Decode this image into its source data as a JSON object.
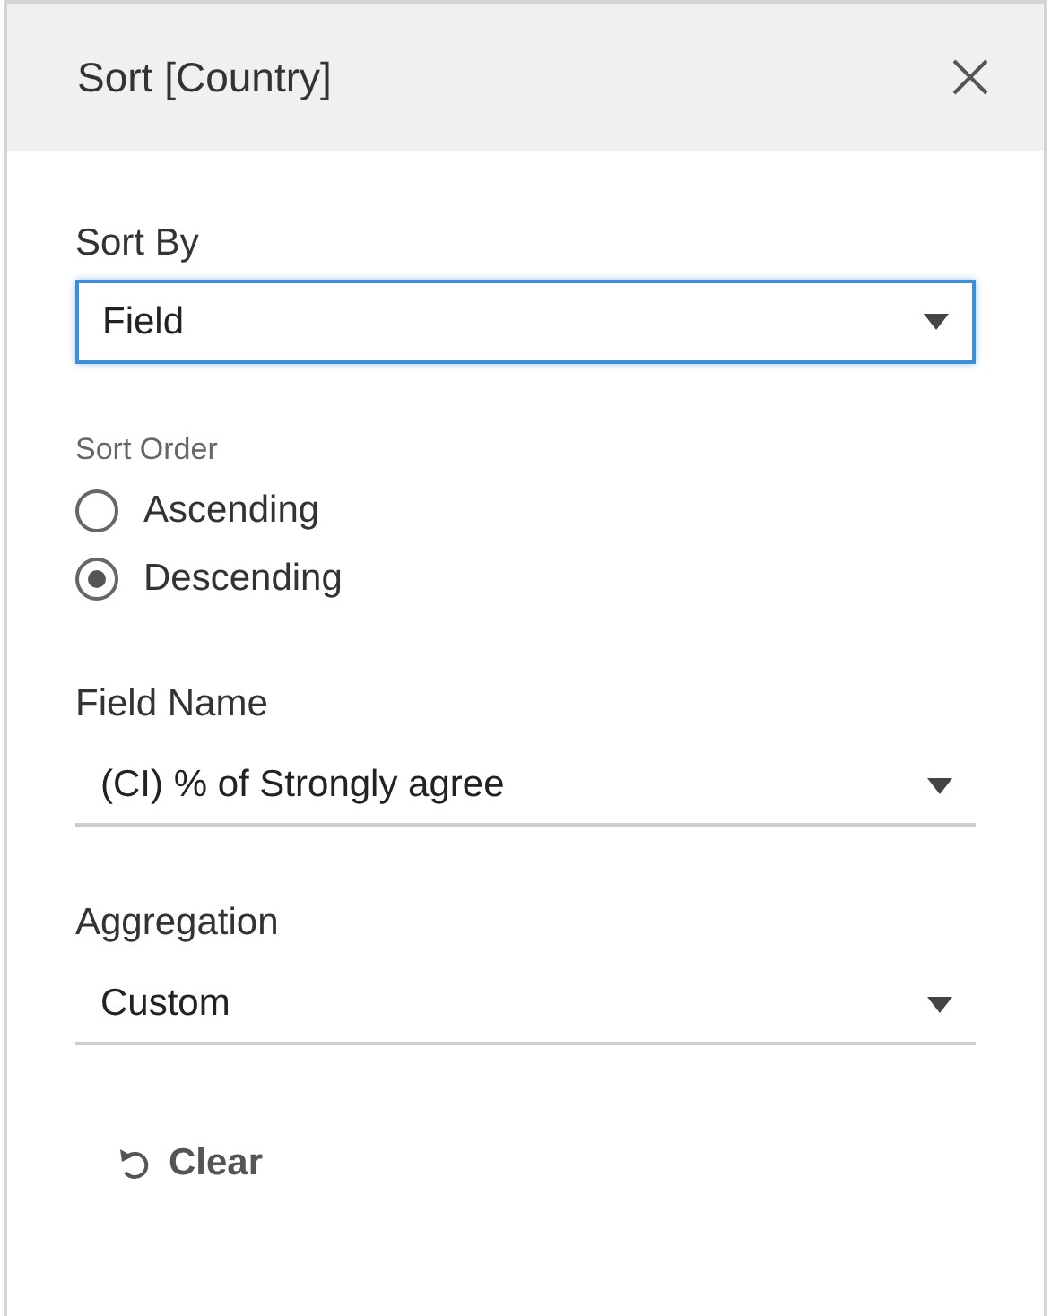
{
  "dialog": {
    "title": "Sort [Country]"
  },
  "sort_by": {
    "label": "Sort By",
    "value": "Field",
    "focused": true
  },
  "sort_order": {
    "label": "Sort Order",
    "options": [
      {
        "label": "Ascending",
        "selected": false
      },
      {
        "label": "Descending",
        "selected": true
      }
    ]
  },
  "field_name": {
    "label": "Field Name",
    "value": "(CI) % of Strongly agree"
  },
  "aggregation": {
    "label": "Aggregation",
    "value": "Custom"
  },
  "clear_button": {
    "label": "Clear"
  }
}
